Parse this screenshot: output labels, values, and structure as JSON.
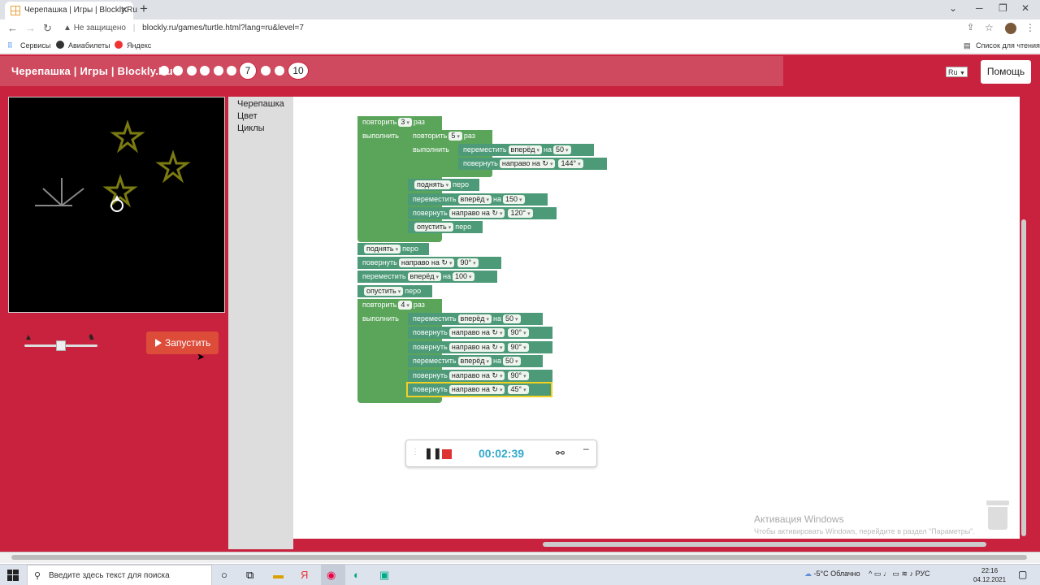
{
  "browser": {
    "tab_title": "Черепашка | Игры | Blockly.Ru",
    "tab_close": "✕",
    "new_tab": "+",
    "security": "Не защищено",
    "url": "blockly.ru/games/turtle.html?lang=ru&level=7",
    "bookmarks": [
      "Сервисы",
      "Авиабилеты",
      "Яндекс"
    ],
    "reading_list": "Список для чтения"
  },
  "app": {
    "title": "Черепашка | Игры | Blockly.Ru",
    "current_level": "7",
    "last_level": "10",
    "language": "Ru",
    "help": "Помощь",
    "run": "Запустить"
  },
  "toolbox": {
    "categories": [
      "Черепашка",
      "Цвет",
      "Циклы"
    ]
  },
  "blocks": {
    "repeat": "повторить",
    "times": "раз",
    "do": "выполнить",
    "move": "переместить",
    "forward": "вперёд",
    "by": "на",
    "turn": "повернуть",
    "right": "направо на ↻",
    "pen_up": "поднять",
    "pen_down": "опустить",
    "pen": "перо",
    "v3": "3",
    "v5": "5",
    "v4": "4",
    "v50": "50",
    "v144": "144°",
    "v150": "150",
    "v120": "120°",
    "v90": "90°",
    "v100": "100",
    "v45": "45°"
  },
  "recorder": {
    "time": "00:02:39"
  },
  "watermark": {
    "line1": "Активация Windows",
    "line2": "Чтобы активировать Windows, перейдите в раздел \"Параметры\"."
  },
  "taskbar": {
    "search": "Введите здесь текст для поиска",
    "weather": "-5°C Облачно",
    "lang": "РУС",
    "time": "22:16",
    "date": "04.12.2021"
  }
}
